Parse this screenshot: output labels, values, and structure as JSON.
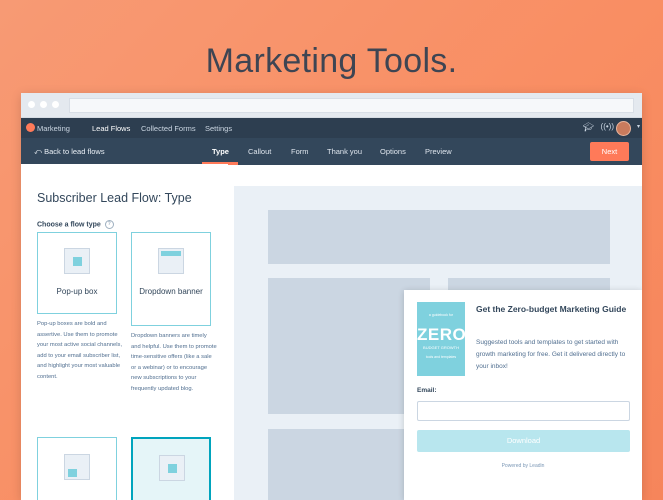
{
  "headline": "Marketing Tools.",
  "topnav": {
    "brand": "Marketing",
    "items": [
      "Lead Flows",
      "Collected Forms",
      "Settings"
    ],
    "active_index": 0,
    "icons": [
      "graduation-cap-icon",
      "broadcast-icon",
      "avatar",
      "chevron-down-icon"
    ]
  },
  "subnav": {
    "back_label": "Back to lead flows",
    "tabs": [
      "Type",
      "Callout",
      "Form",
      "Thank you",
      "Options",
      "Preview"
    ],
    "active_tab": "Type",
    "next_label": "Next"
  },
  "panel": {
    "title": "Subscriber Lead Flow: Type",
    "choose_label": "Choose a flow type",
    "cards": [
      {
        "label": "Pop-up box",
        "description": "Pop-up boxes are bold and assertive. Use them to promote your most active social channels, add to your email subscriber list, and highlight your most valuable content."
      },
      {
        "label": "Dropdown banner",
        "description": "Dropdown banners are timely and helpful. Use them to promote time-sensitive offers (like a sale or a webinar) or to encourage new subscriptions to your frequently updated blog."
      }
    ]
  },
  "popup": {
    "book": {
      "small": "a guidebook for",
      "big": "ZERO",
      "mid": "BUDGET GROWTH",
      "foot": "tools and templates"
    },
    "title": "Get the Zero-budget Marketing Guide",
    "body": "Suggested tools and templates to get started with growth marketing for free. Get it delivered directly to your inbox!",
    "email_label": "Email:",
    "email_value": "",
    "button_label": "Download",
    "powered_by": "Powered by Leadin"
  },
  "colors": {
    "background": "#f98e63",
    "accent": "#ff7a59",
    "teal": "#00a4bd",
    "nav_dark": "#2d3e50"
  }
}
